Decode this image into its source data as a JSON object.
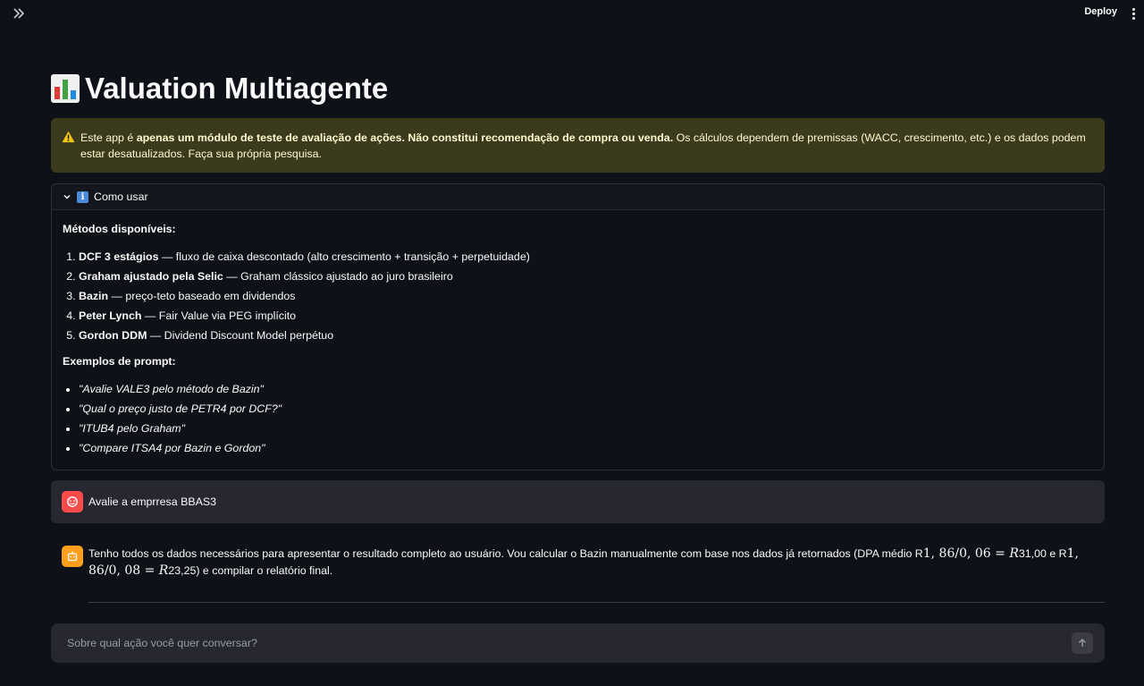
{
  "header": {
    "deploy_label": "Deploy"
  },
  "page": {
    "title": "Valuation Multiagente"
  },
  "warning": {
    "prefix": "Este app é ",
    "bold": "apenas um módulo de teste de avaliação de ações. Não constitui recomendação de compra ou venda.",
    "rest": " Os cálculos dependem de premissas (WACC, crescimento, etc.) e os dados podem estar desatualizados. Faça sua própria pesquisa."
  },
  "expander": {
    "label": "Como usar",
    "methods_heading": "Métodos disponíveis:",
    "methods": [
      {
        "name": "DCF 3 estágios",
        "desc": " — fluxo de caixa descontado (alto crescimento + transição + perpetuidade)"
      },
      {
        "name": "Graham ajustado pela Selic",
        "desc": " — Graham clássico ajustado ao juro brasileiro"
      },
      {
        "name": "Bazin",
        "desc": " — preço-teto baseado em dividendos"
      },
      {
        "name": "Peter Lynch",
        "desc": " — Fair Value via PEG implícito"
      },
      {
        "name": "Gordon DDM",
        "desc": " — Dividend Discount Model perpétuo"
      }
    ],
    "examples_heading": "Exemplos de prompt:",
    "examples": [
      "\"Avalie VALE3 pelo método de Bazin\"",
      "\"Qual o preço justo de PETR4 por DCF?\"",
      "\"ITUB4 pelo Graham\"",
      "\"Compare ITSA4 por Bazin e Gordon\""
    ]
  },
  "chat": {
    "user_message": "Avalie a emprresa BBAS3",
    "bot_message": {
      "part1": "Tenho todos os dados necessários para apresentar o resultado completo ao usuário. Vou calcular o Bazin manualmente com base nos dados já retornados (DPA médio R",
      "math1": "1, 86/0, 06 = ",
      "math1_var": "R",
      "part2": "31,00 e R",
      "math2": "1, 86/0, 08 = ",
      "math2_var": "R",
      "part3": "23,25) e compilar o relatório final."
    },
    "input_placeholder": "Sobre qual ação você quer conversar?"
  }
}
